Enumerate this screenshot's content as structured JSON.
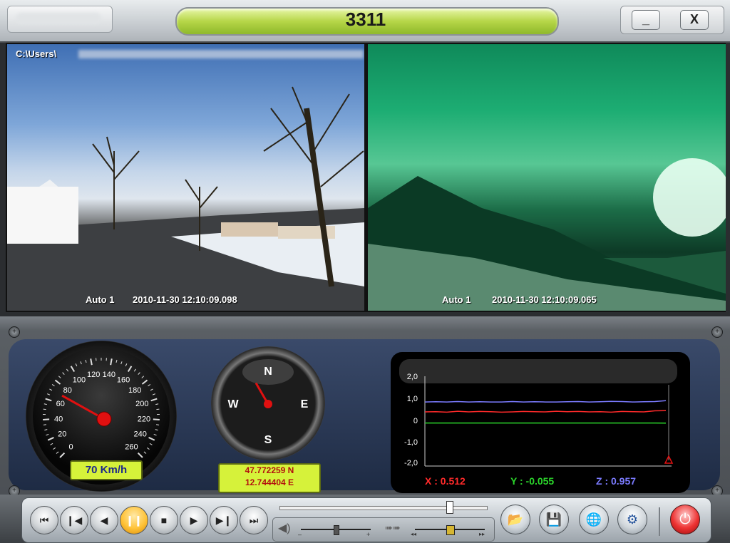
{
  "window": {
    "title": "3311",
    "minimize_label": "_",
    "close_label": "X"
  },
  "cameras": [
    {
      "path": "C:\\Users\\",
      "channel": "Auto 1",
      "timestamp": "2010-11-30 12:10:09.098"
    },
    {
      "channel": "Auto 1",
      "timestamp": "2010-11-30 12:10:09.065"
    }
  ],
  "speedometer": {
    "ticks": [
      "0",
      "20",
      "40",
      "60",
      "80",
      "100",
      "120",
      "140",
      "160",
      "180",
      "200",
      "220",
      "240",
      "260"
    ],
    "speed_value": 70,
    "readout": "70 Km/h",
    "max": 260
  },
  "compass": {
    "north": "N",
    "east": "E",
    "south": "S",
    "west": "W",
    "heading_deg": 330,
    "latitude": "47.772259 N",
    "longitude": "12.744404 E"
  },
  "accelerometer": {
    "y_ticks": [
      "2,0",
      "1,0",
      "0",
      "-1,0",
      "-2,0"
    ],
    "x_readout": "X : 0.512",
    "y_readout": "Y : -0.055",
    "z_readout": "Z : 0.957",
    "colors": {
      "x": "#ff2a2a",
      "y": "#2bd62b",
      "z": "#7b7bff"
    },
    "chart_data": {
      "type": "line",
      "ylim": [
        -2,
        2
      ],
      "series": [
        {
          "name": "X",
          "values": [
            0.45,
            0.46,
            0.44,
            0.48,
            0.45,
            0.47,
            0.46,
            0.44,
            0.45,
            0.47,
            0.46,
            0.45,
            0.48,
            0.46,
            0.47,
            0.45,
            0.46,
            0.44,
            0.47,
            0.46,
            0.45,
            0.5,
            0.51
          ]
        },
        {
          "name": "Y",
          "values": [
            -0.05,
            -0.05,
            -0.05,
            -0.05,
            -0.05,
            -0.05,
            -0.05,
            -0.05,
            -0.05,
            -0.05,
            -0.05,
            -0.05,
            -0.05,
            -0.05,
            -0.05,
            -0.05,
            -0.05,
            -0.05,
            -0.05,
            -0.05,
            -0.05,
            -0.05,
            -0.055
          ]
        },
        {
          "name": "Z",
          "values": [
            0.9,
            0.91,
            0.9,
            0.92,
            0.9,
            0.91,
            0.9,
            0.9,
            0.92,
            0.9,
            0.91,
            0.9,
            0.9,
            0.91,
            0.92,
            0.9,
            0.91,
            0.93,
            0.92,
            0.9,
            0.91,
            0.92,
            0.957
          ]
        }
      ]
    }
  },
  "playback": {
    "first_icon": "skip-first-icon",
    "prev_icon": "step-back-icon",
    "back_icon": "play-backward-icon",
    "pause_icon": "pause-icon",
    "stop_icon": "stop-icon",
    "play_icon": "play-icon",
    "next_icon": "step-forward-icon",
    "last_icon": "skip-last-icon",
    "position_fraction": 0.82
  },
  "sub_controls": {
    "volume_icon": "speaker-icon",
    "volume_minus": "–",
    "volume_plus": "+",
    "volume_fraction": 0.5,
    "speed_icon": "fast-forward-icon",
    "speed_minus": "◂◂",
    "speed_plus": "▸▸",
    "speed_fraction": 0.5
  },
  "tools": [
    "folder-open-icon",
    "save-icon",
    "globe-icon",
    "settings-icon",
    "power-icon"
  ],
  "colors": {
    "accent_green": "#b6d648",
    "readout_bg": "#d6f23a",
    "needle": "#e01010"
  }
}
